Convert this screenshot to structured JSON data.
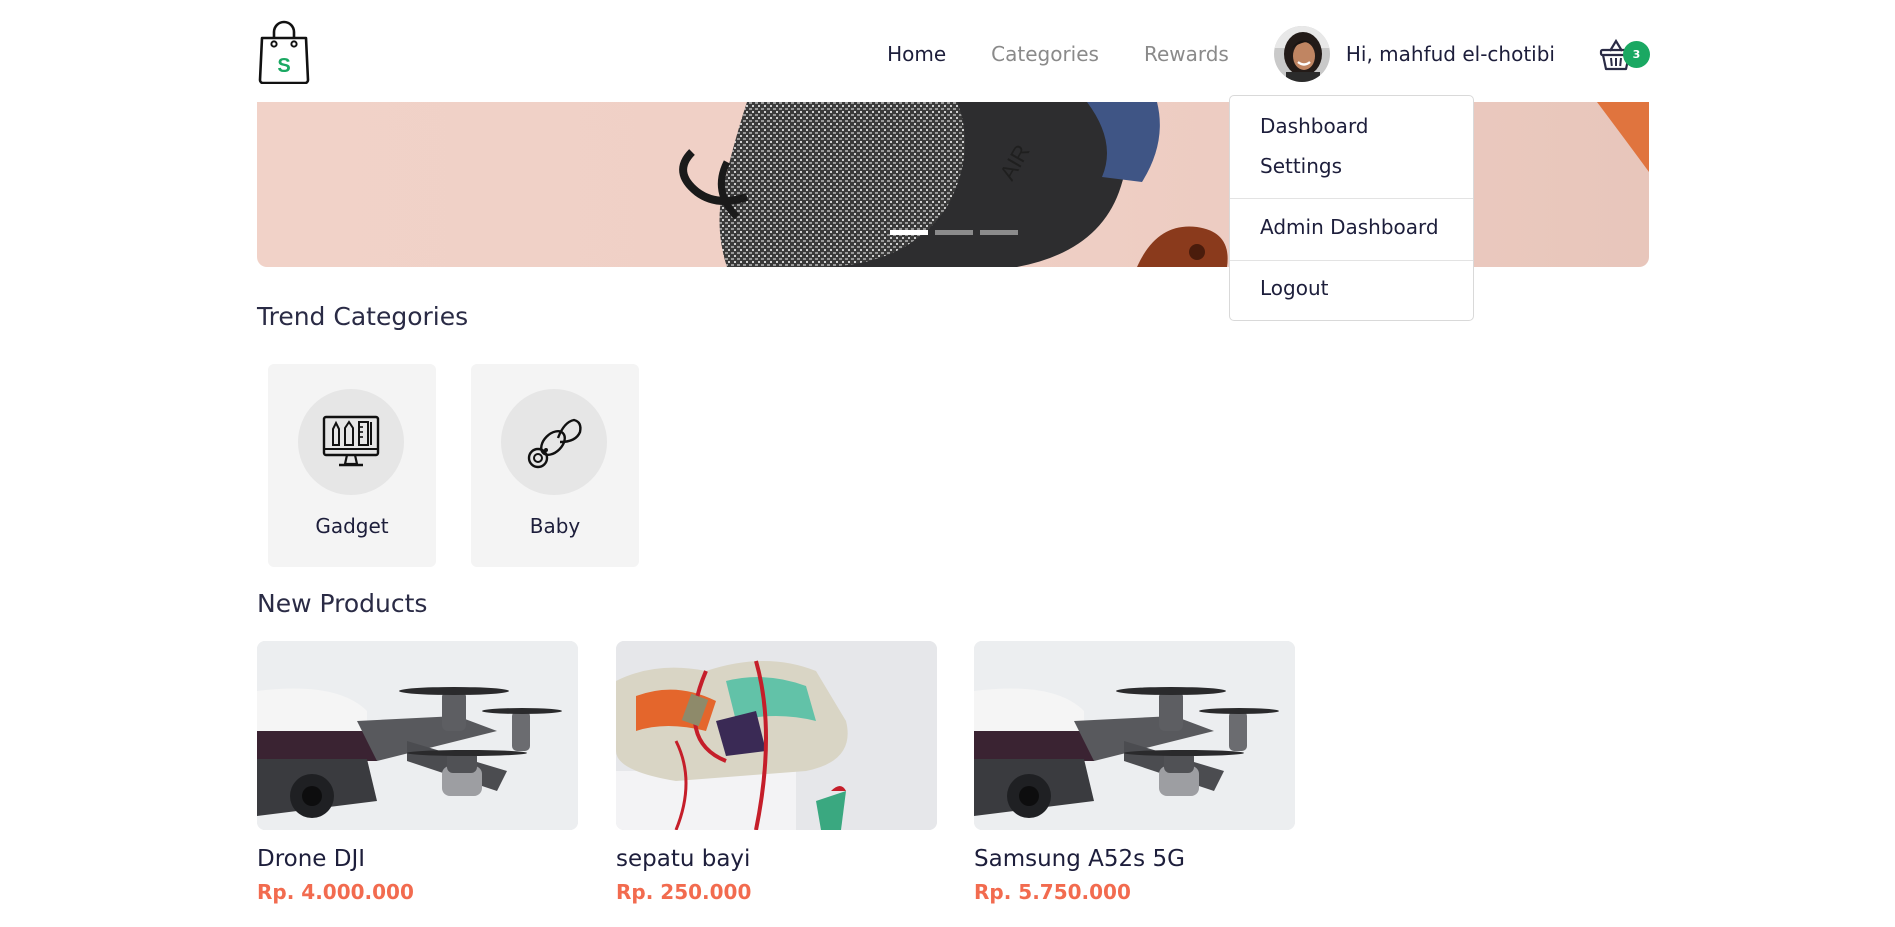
{
  "navbar": {
    "logo_letter": "S",
    "links": [
      {
        "label": "Home"
      },
      {
        "label": "Categories"
      },
      {
        "label": "Rewards"
      }
    ],
    "user_greeting": "Hi, mahfud el-chotibi",
    "cart_count": "3"
  },
  "hero": {
    "slide_count": 3,
    "active_slide": 1
  },
  "dropdown": {
    "items": [
      {
        "label": "Dashboard"
      },
      {
        "label": "Settings"
      },
      {
        "label": "Admin Dashboard"
      },
      {
        "label": "Logout"
      }
    ]
  },
  "trend_categories": {
    "title": "Trend Categories",
    "items": [
      {
        "label": "Gadget",
        "icon": "computer-icon"
      },
      {
        "label": "Baby",
        "icon": "pacifier-icon"
      }
    ]
  },
  "new_products": {
    "title": "New Products",
    "items": [
      {
        "name": "Drone DJI",
        "price": "Rp. 4.000.000",
        "image": "drone-image"
      },
      {
        "name": "sepatu bayi",
        "price": "Rp. 250.000",
        "image": "shoe-image"
      },
      {
        "name": "Samsung A52s 5G",
        "price": "Rp. 5.750.000",
        "image": "drone-image"
      }
    ]
  },
  "colors": {
    "accent_green": "#1aa862",
    "price_orange": "#f26b4f",
    "text_dark": "#1d1e3b",
    "muted": "#8a8a8a"
  }
}
